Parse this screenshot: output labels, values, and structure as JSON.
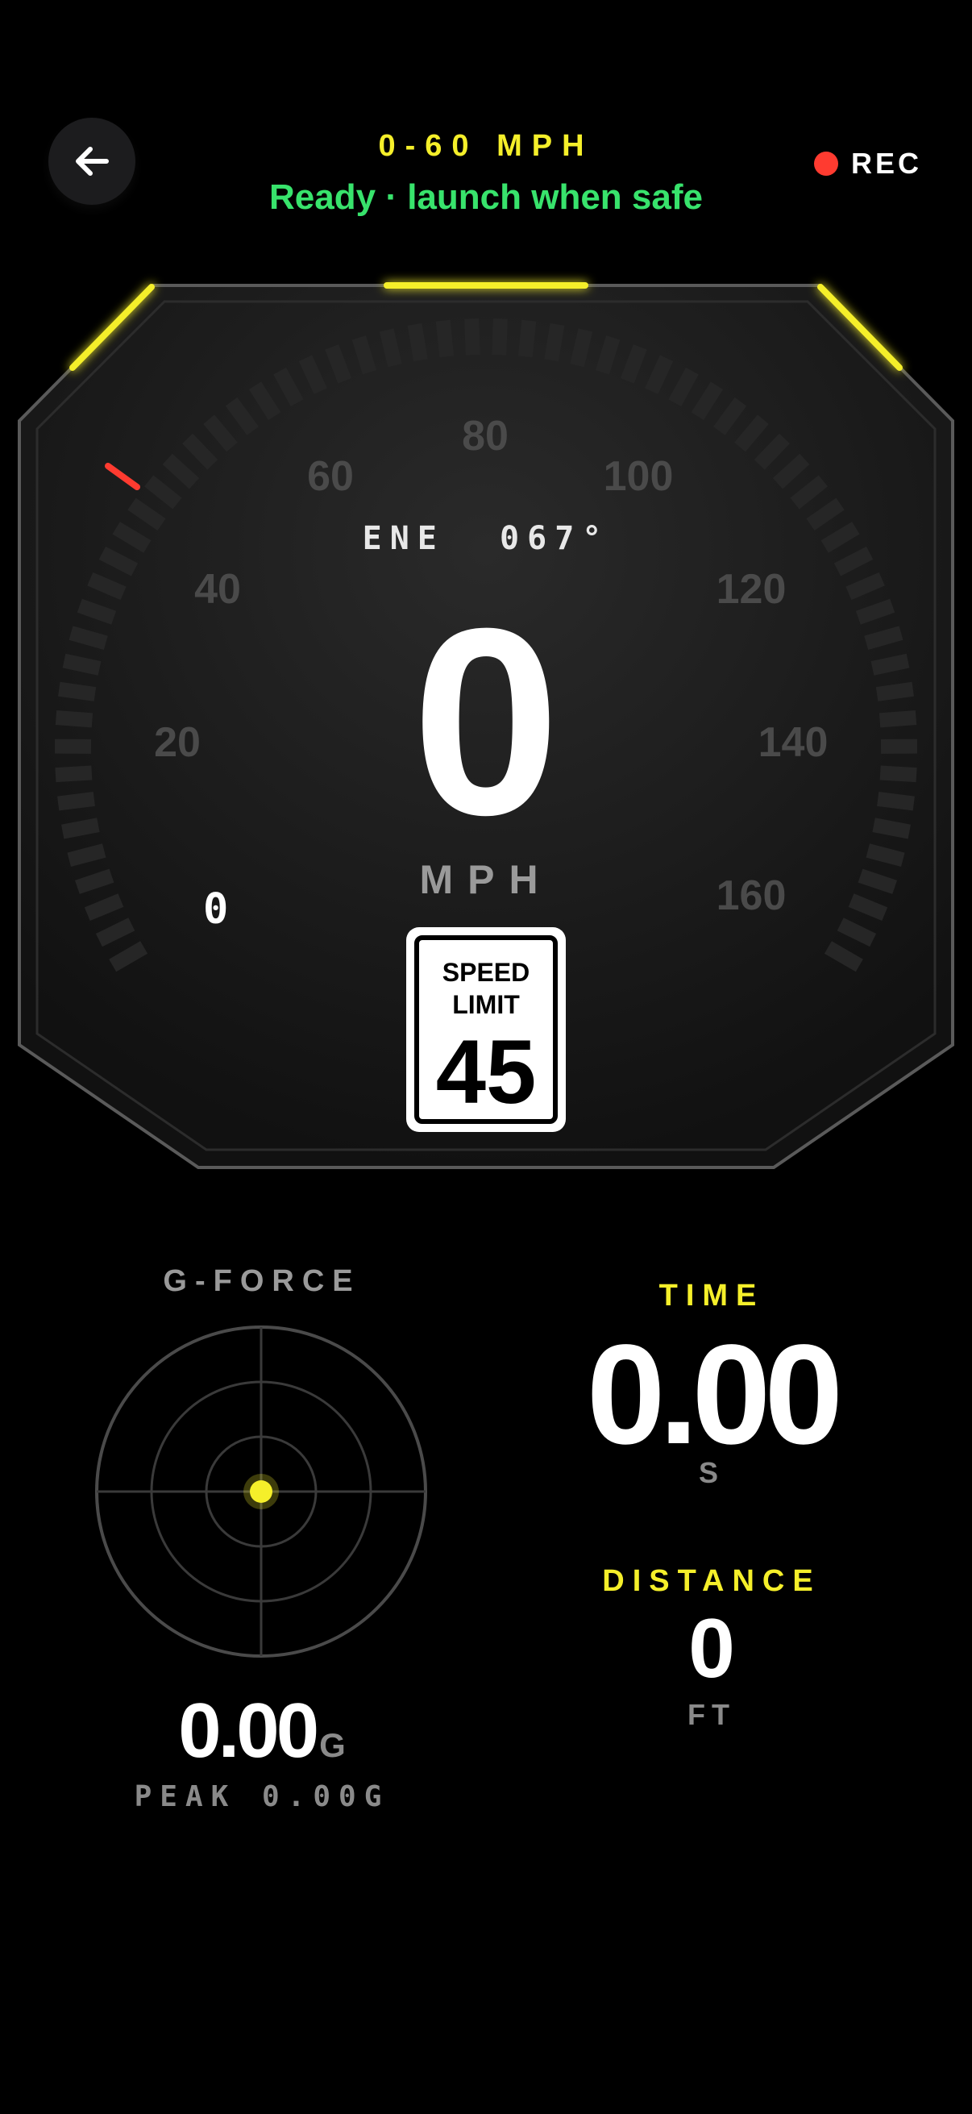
{
  "header": {
    "back_icon": "arrow-left-icon",
    "title": "0-60 MPH",
    "status": "Ready · launch when safe",
    "status_color": "#38e36c",
    "recording_label": "REC",
    "recording_color": "#ff3b30"
  },
  "gauge": {
    "accent_color": "#f5ef2a",
    "heading": "ENE  067°",
    "speed_value": "0",
    "speed_unit": "MPH",
    "scale_labels": [
      "0",
      "20",
      "40",
      "60",
      "80",
      "100",
      "120",
      "140",
      "160"
    ],
    "speed_limit": {
      "line1": "SPEED",
      "line2": "LIMIT",
      "value": "45"
    }
  },
  "gforce": {
    "label": "G-FORCE",
    "value": "0.00",
    "unit": "G",
    "peak": "PEAK 0.00G",
    "dot_color": "#f5ef2a"
  },
  "time": {
    "label": "TIME",
    "value": "0.00",
    "unit": "S"
  },
  "distance": {
    "label": "DISTANCE",
    "value": "0",
    "unit": "FT"
  }
}
